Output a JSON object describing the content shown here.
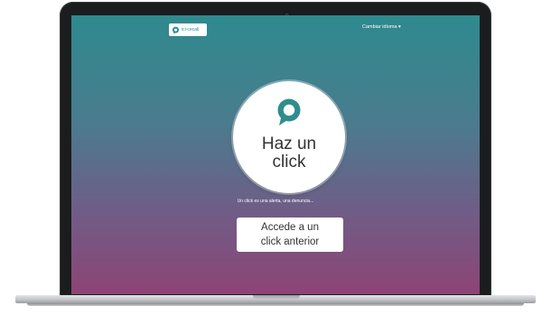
{
  "header": {
    "logo_text": "ici-cecali",
    "language_menu": "Cambiar idioma ▾"
  },
  "hero": {
    "button_line1": "Haz un",
    "button_line2": "click",
    "tagline": "Un click es una alerta, una denuncia..."
  },
  "cta": {
    "line1": "Accede a un",
    "line2": "click anterior"
  },
  "colors": {
    "gradient_top": "#2e8a8e",
    "gradient_bottom": "#8d4475",
    "accent": "#2f8d8e",
    "button_text": "#333333"
  },
  "icons": {
    "logo": "speech-bubble-logo-icon",
    "hero": "speech-bubble-icon"
  }
}
